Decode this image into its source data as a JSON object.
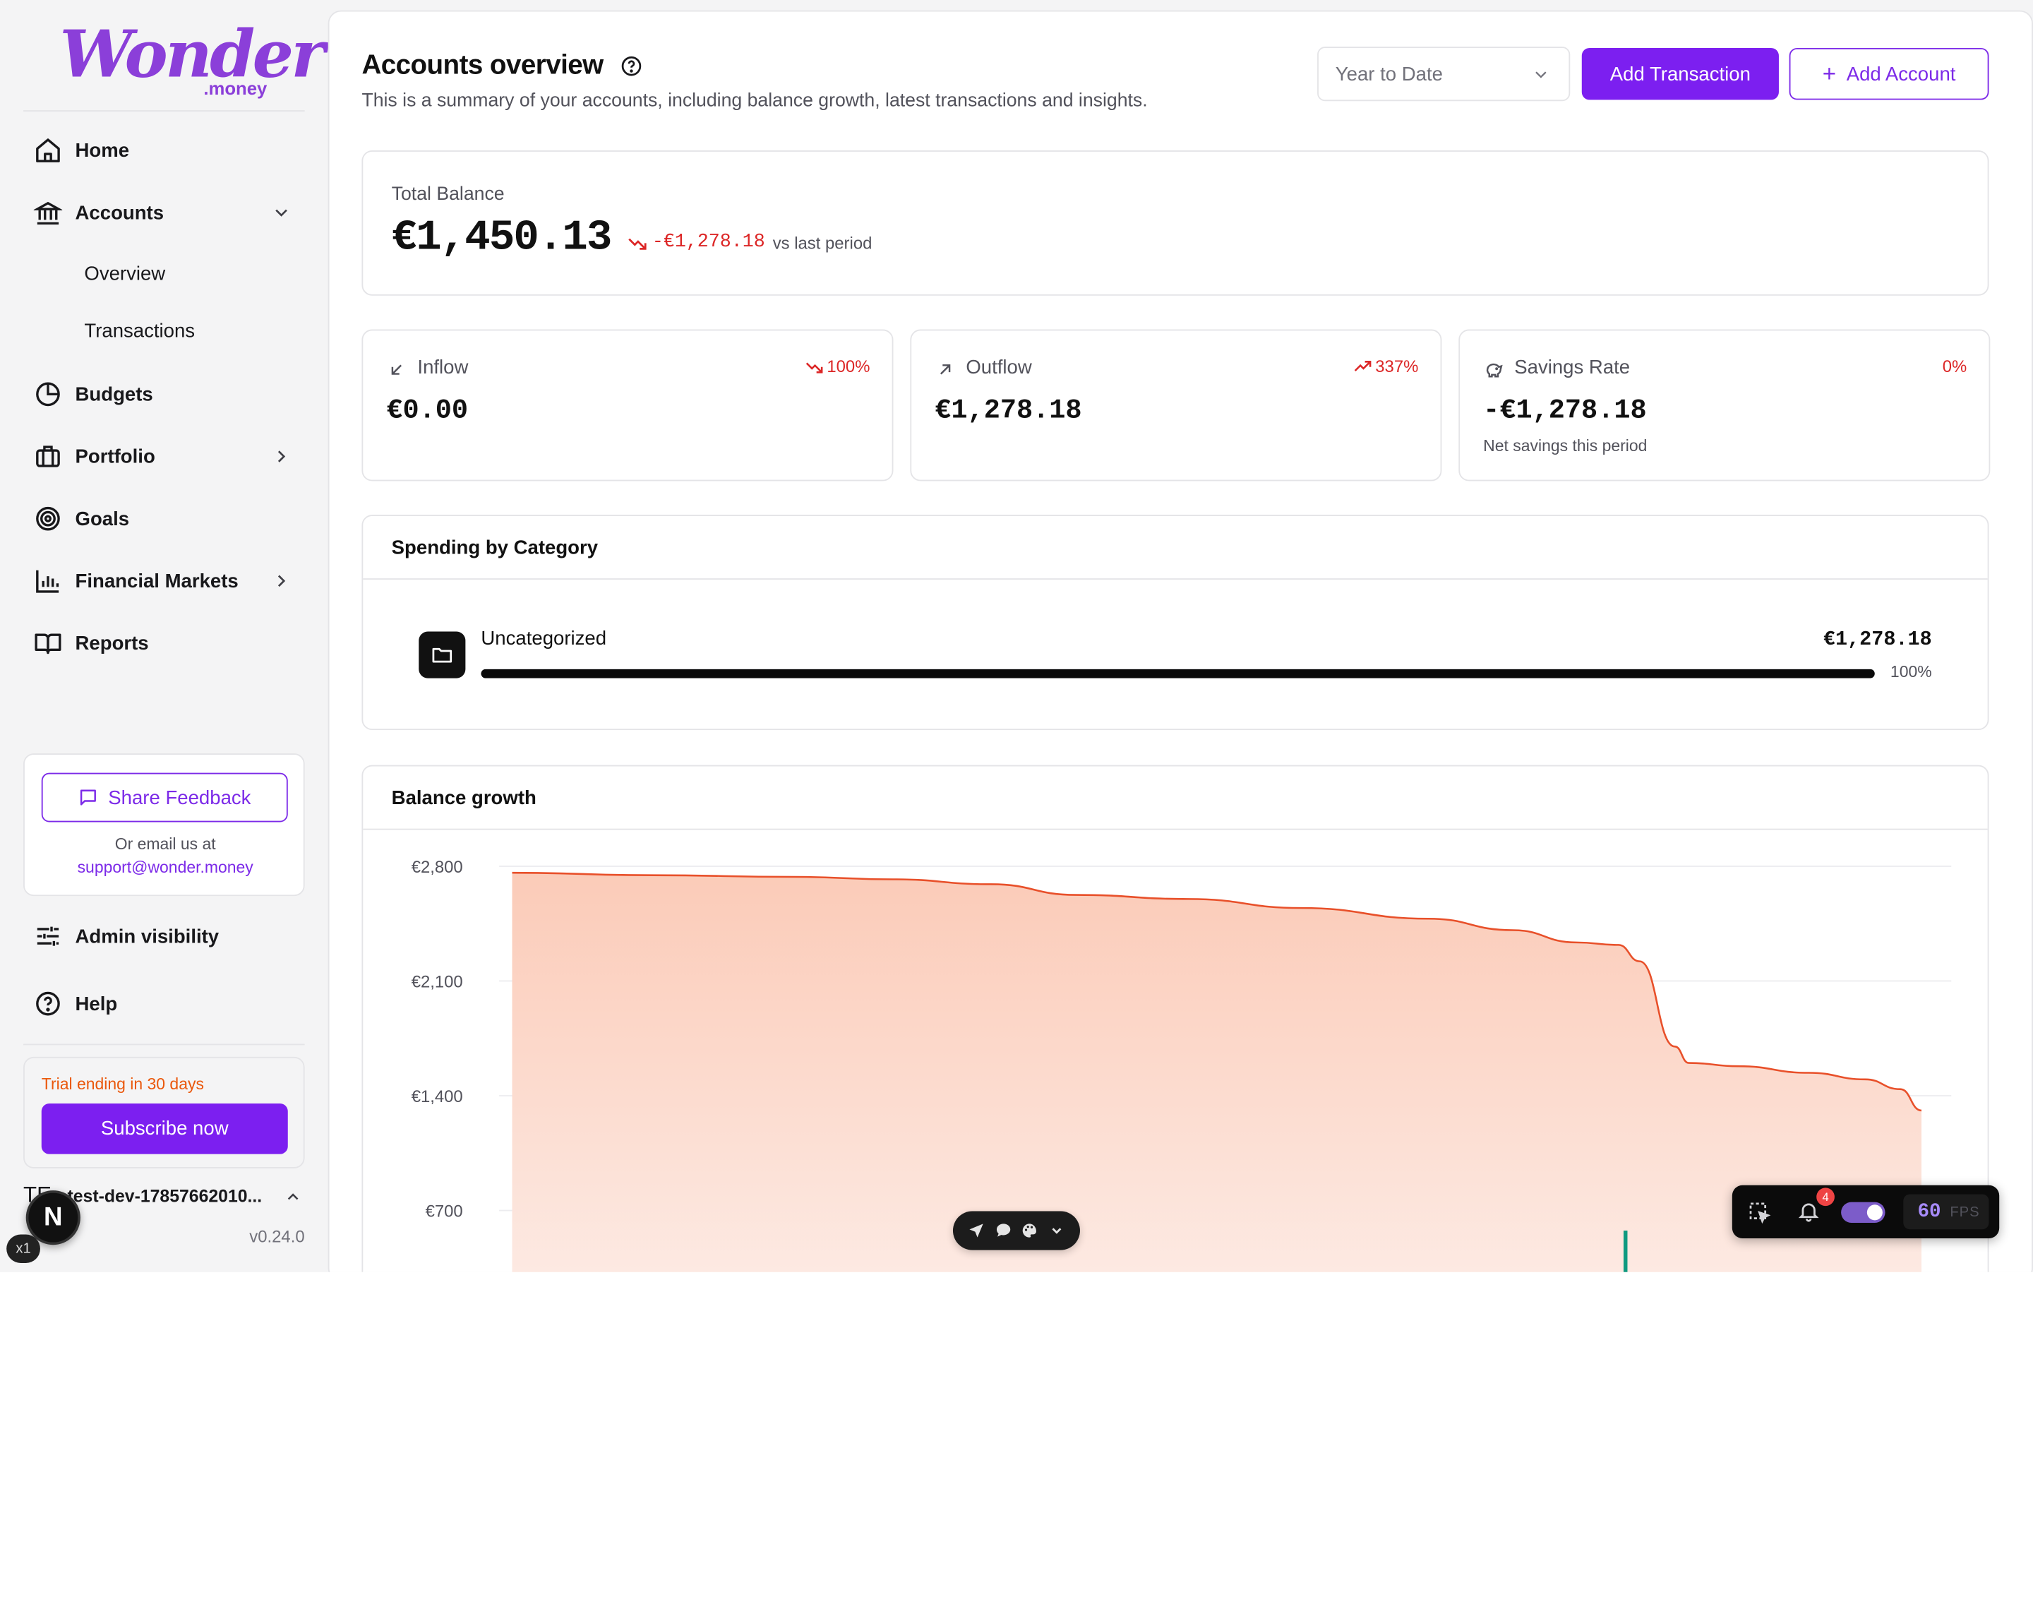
{
  "brand": {
    "name": "Wonder",
    "suffix": ".money",
    "accent": "#7c1ff0"
  },
  "sidebar": {
    "nav": [
      {
        "label": "Home",
        "icon": "home-icon"
      },
      {
        "label": "Accounts",
        "icon": "bank-icon",
        "expanded": true
      },
      {
        "label": "Budgets",
        "icon": "pie-chart-icon"
      },
      {
        "label": "Portfolio",
        "icon": "briefcase-icon"
      },
      {
        "label": "Goals",
        "icon": "target-icon"
      },
      {
        "label": "Financial Markets",
        "icon": "bar-chart-icon"
      },
      {
        "label": "Reports",
        "icon": "book-open-icon"
      }
    ],
    "accounts_sub": [
      "Overview",
      "Transactions"
    ],
    "feedback": {
      "button": "Share Feedback",
      "note": "Or email us at",
      "email": "support@wonder.money"
    },
    "admin_visibility": "Admin visibility",
    "help": "Help",
    "trial": {
      "text": "Trial ending in 30 days",
      "button": "Subscribe now"
    },
    "user": {
      "initials": "TE",
      "name": "test-dev-17857662010..."
    },
    "version": "v0.24.0"
  },
  "header": {
    "title": "Accounts overview",
    "description": "This is a summary of your accounts, including balance growth, latest transactions and insights.",
    "period": "Year to Date",
    "add_transaction": "Add Transaction",
    "add_account": "Add Account"
  },
  "total_balance": {
    "label": "Total Balance",
    "value": "€1,450.13",
    "delta": "-€1,278.18",
    "delta_note": "vs last period"
  },
  "stats": [
    {
      "label": "Inflow",
      "icon": "arrow-down-left-icon",
      "trend": "100%",
      "trend_icon": "trending-down-icon",
      "value": "€0.00",
      "note": ""
    },
    {
      "label": "Outflow",
      "icon": "arrow-up-right-icon",
      "trend": "337%",
      "trend_icon": "trending-up-icon",
      "value": "€1,278.18",
      "note": ""
    },
    {
      "label": "Savings Rate",
      "icon": "piggy-bank-icon",
      "trend": "0%",
      "trend_icon": "",
      "value": "-€1,278.18",
      "note": "Net savings this period"
    }
  ],
  "spending": {
    "title": "Spending by Category",
    "categories": [
      {
        "name": "Uncategorized",
        "amount": "€1,278.18",
        "percent_label": "100%",
        "share": 1.0,
        "icon": "folder-icon"
      }
    ]
  },
  "balance_growth": {
    "title": "Balance growth"
  },
  "chart_data": {
    "type": "area",
    "title": "Balance growth",
    "xlabel": "",
    "ylabel": "",
    "y_ticks": [
      "€2,800",
      "€2,100",
      "€1,400",
      "€700"
    ],
    "y_tick_values": [
      2800,
      2100,
      1400,
      700
    ],
    "ylim": [
      0,
      2900
    ],
    "grid": true,
    "series": [
      {
        "name": "",
        "color": "#e8502a",
        "points": [
          [
            0,
            2760
          ],
          [
            0.1,
            2745
          ],
          [
            0.2,
            2735
          ],
          [
            0.27,
            2720
          ],
          [
            0.34,
            2690
          ],
          [
            0.4,
            2625
          ],
          [
            0.48,
            2600
          ],
          [
            0.56,
            2545
          ],
          [
            0.65,
            2480
          ],
          [
            0.71,
            2410
          ],
          [
            0.755,
            2335
          ],
          [
            0.785,
            2320
          ],
          [
            0.8,
            2220
          ],
          [
            0.825,
            1700
          ],
          [
            0.835,
            1600
          ],
          [
            0.87,
            1580
          ],
          [
            0.92,
            1540
          ],
          [
            0.96,
            1500
          ],
          [
            0.985,
            1440
          ],
          [
            1.0,
            1310
          ]
        ]
      }
    ]
  },
  "devtools": {
    "next_badge": "N",
    "zoom_badge": "x1",
    "notifications": "4",
    "fps": "60",
    "fps_unit": "FPS"
  }
}
